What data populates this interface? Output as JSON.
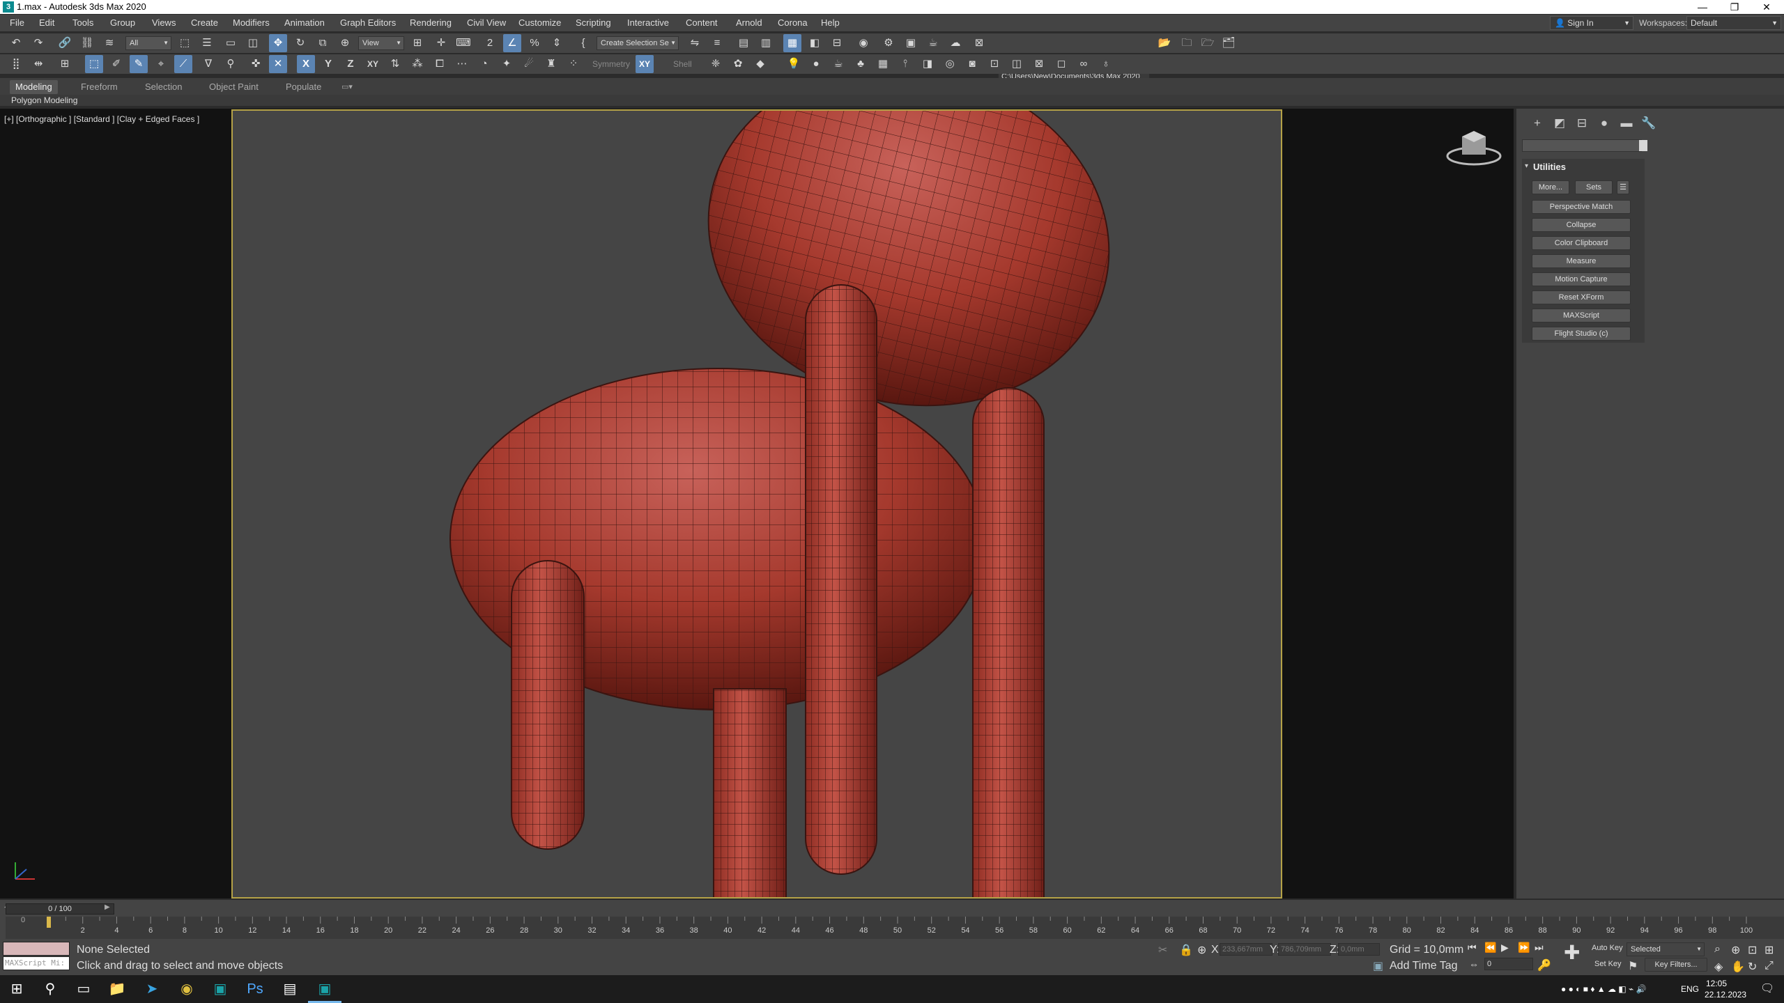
{
  "window": {
    "title": "1.max - Autodesk 3ds Max 2020",
    "minimize": "—",
    "restore": "❐",
    "close": "✕"
  },
  "menu": [
    "File",
    "Edit",
    "Tools",
    "Group",
    "Views",
    "Create",
    "Modifiers",
    "Animation",
    "Graph Editors",
    "Rendering",
    "Civil View",
    "Customize",
    "Scripting",
    "Interactive",
    "Content",
    "Arnold",
    "Corona",
    "Help"
  ],
  "account": {
    "sign_in": "Sign In",
    "workspaces_label": "Workspaces:",
    "workspace": "Default"
  },
  "toolbar1": {
    "selection_filter": "All",
    "ref_coord": "View",
    "named_selection": "Create Selection Se",
    "project_path": "C:\\Users\\New\\Documents\\3ds Max 2020"
  },
  "toolbar2": {
    "symmetry": "Symmetry",
    "shell": "Shell",
    "axis_x": "X",
    "axis_y": "Y",
    "axis_z": "Z",
    "axis_xy": "XY",
    "axis_xy2": "XY"
  },
  "ribbon": {
    "tabs": [
      "Modeling",
      "Freeform",
      "Selection",
      "Object Paint",
      "Populate"
    ],
    "active_tab": "Modeling",
    "panel": "Polygon Modeling"
  },
  "viewport": {
    "label": "[+] [Orthographic ] [Standard ] [Clay + Edged Faces ]",
    "mesh_color": "#b84a3e",
    "background": "#454545",
    "frame_color": "#b5a247"
  },
  "command_panel": {
    "title": "Utilities",
    "more": "More...",
    "sets": "Sets",
    "buttons": [
      "Perspective Match",
      "Collapse",
      "Color Clipboard",
      "Measure",
      "Motion Capture",
      "Reset XForm",
      "MAXScript",
      "Flight Studio (c)"
    ]
  },
  "timeline": {
    "frame": "0 / 100",
    "ticks": [
      "0",
      "2",
      "4",
      "6",
      "8",
      "10",
      "12",
      "14",
      "16",
      "18",
      "20",
      "22",
      "24",
      "26",
      "28",
      "30",
      "32",
      "34",
      "36",
      "38",
      "40",
      "42",
      "44",
      "46",
      "48",
      "50",
      "52",
      "54",
      "56",
      "58",
      "60",
      "62",
      "64",
      "66",
      "68",
      "70",
      "72",
      "74",
      "76",
      "78",
      "80",
      "82",
      "84",
      "86",
      "88",
      "90",
      "92",
      "94",
      "96",
      "98",
      "100"
    ]
  },
  "status": {
    "selection": "None Selected",
    "prompt": "Click and drag to select and move objects",
    "maxscript": "MAXScript Mi:",
    "x_label": "X:",
    "x_value": "233,667mm",
    "y_label": "Y:",
    "y_value": "786,709mm",
    "z_label": "Z:",
    "z_value": "0,0mm",
    "grid": "Grid = 10,0mm",
    "add_time_tag": "Add Time Tag",
    "auto_key": "Auto Key",
    "set_key": "Set Key",
    "selected": "Selected",
    "key_filters": "Key Filters...",
    "frame_value": "0"
  },
  "tray": {
    "lang": "ENG",
    "time": "12:05",
    "date": "22.12.2023"
  }
}
